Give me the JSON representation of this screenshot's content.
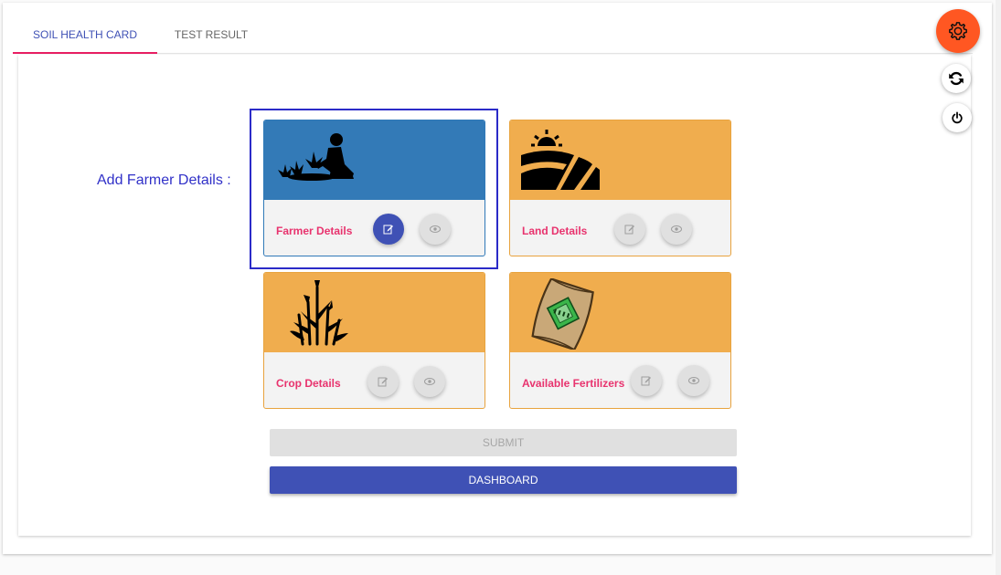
{
  "tabs": [
    {
      "label": "SOIL HEALTH CARD",
      "active": true
    },
    {
      "label": "TEST RESULT",
      "active": false
    }
  ],
  "prompt": "Add Farmer Details :",
  "cards": [
    {
      "label": "Farmer Details",
      "image": "farmer-planting-icon",
      "header_color": "#337ab7",
      "edit_active": true
    },
    {
      "label": "Land Details",
      "image": "land-sunrise-field-icon",
      "header_color": "#f0ad4e",
      "edit_active": false
    },
    {
      "label": "Crop Details",
      "image": "crop-plants-icon",
      "header_color": "#f0ad4e",
      "edit_active": false
    },
    {
      "label": "Available Fertilizers",
      "image": "npk-fertilizer-bag-icon",
      "header_color": "#f0ad4e",
      "edit_active": false
    }
  ],
  "buttons": {
    "submit": "SUBMIT",
    "dashboard": "DASHBOARD"
  },
  "side_actions": [
    "gear-icon",
    "sync-icon",
    "power-icon"
  ],
  "colors": {
    "primary": "#3f51b5",
    "accent": "#e91e63",
    "settings": "#ff5722",
    "label": "#e8336e"
  }
}
